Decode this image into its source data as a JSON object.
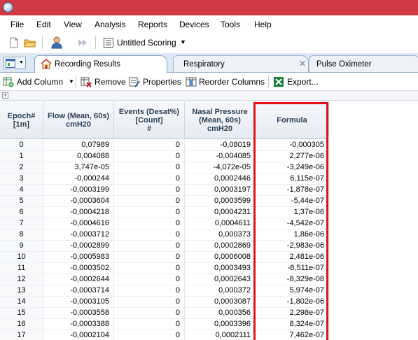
{
  "menu": [
    "File",
    "Edit",
    "View",
    "Analysis",
    "Reports",
    "Devices",
    "Tools",
    "Help"
  ],
  "toolbar": {
    "scoring_label": "Untitled Scoring",
    "icons": [
      "new-document-icon",
      "open-folder-icon",
      "user-icon",
      "play-forward-icon",
      "scoring-icon",
      "dropdown-arrow-icon"
    ]
  },
  "tabs": [
    {
      "label": "Recording Results",
      "active": true
    },
    {
      "label": "Respiratory",
      "active": false
    },
    {
      "label": "Pulse Oximeter",
      "active": false
    }
  ],
  "toolbar2": {
    "add_column": "Add Column",
    "remove": "Remove",
    "properties": "Properties",
    "reorder": "Reorder Columns",
    "export": "Export..."
  },
  "grid": {
    "headers": [
      [
        "Epoch#",
        "[1m]"
      ],
      [
        "Flow (Mean, 60s)",
        "cmH20"
      ],
      [
        "Events (Desat%)",
        "[Count]",
        "#"
      ],
      [
        "Nasal Pressure",
        "(Mean, 60s)",
        "cmH20"
      ],
      [
        "Formula"
      ]
    ],
    "rows": [
      [
        "0",
        "0,07989",
        "0",
        "-0,08019",
        "-0,000305"
      ],
      [
        "1",
        "0,004088",
        "0",
        "-0,004085",
        "2,277e-06"
      ],
      [
        "2",
        "3,747e-05",
        "0",
        "-4,072e-05",
        "-3,249e-06"
      ],
      [
        "3",
        "-0,000244",
        "0",
        "0,0002446",
        "6,115e-07"
      ],
      [
        "4",
        "-0,0003199",
        "0",
        "0,0003197",
        "-1,878e-07"
      ],
      [
        "5",
        "-0,0003604",
        "0",
        "0,0003599",
        "-5,44e-07"
      ],
      [
        "6",
        "-0,0004218",
        "0",
        "0,0004231",
        "1,37e-06"
      ],
      [
        "7",
        "-0,0004616",
        "0",
        "0,0004611",
        "-4,542e-07"
      ],
      [
        "8",
        "-0,0003712",
        "0",
        "0,000373",
        "1,86e-06"
      ],
      [
        "9",
        "-0,0002899",
        "0",
        "0,0002869",
        "-2,983e-06"
      ],
      [
        "10",
        "-0,0005983",
        "0",
        "0,0006008",
        "2,481e-06"
      ],
      [
        "11",
        "-0,0003502",
        "0",
        "0,0003493",
        "-8,511e-07"
      ],
      [
        "12",
        "-0,0002644",
        "0",
        "0,0002643",
        "-8,329e-08"
      ],
      [
        "13",
        "-0,0003714",
        "0",
        "0,000372",
        "5,974e-07"
      ],
      [
        "14",
        "-0,0003105",
        "0",
        "0,0003087",
        "-1,802e-06"
      ],
      [
        "15",
        "-0,0003558",
        "0",
        "0,000356",
        "2,298e-07"
      ],
      [
        "16",
        "-0,0003388",
        "0",
        "0,0003396",
        "8,324e-07"
      ],
      [
        "17",
        "-0,0002104",
        "0",
        "0,0002111",
        "7,462e-07"
      ]
    ]
  },
  "colors": {
    "titlebar": "#cf3a45",
    "highlight": "#e0121b",
    "tabstrip": "#dde8f5"
  }
}
